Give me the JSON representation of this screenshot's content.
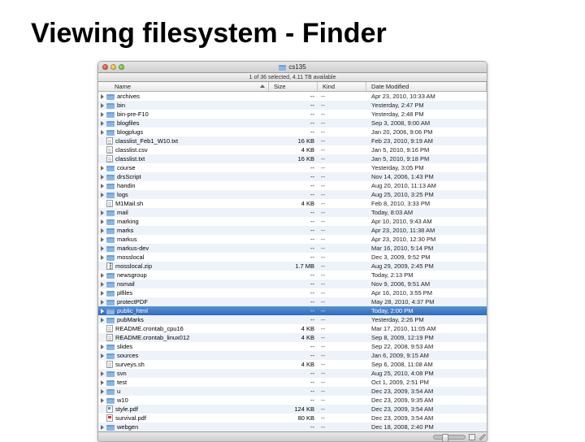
{
  "slide_title": "Viewing filesystem - Finder",
  "window_title": "cs135",
  "status_line": "1 of 36 selected, 4.11 TB available",
  "columns": {
    "name": "Name",
    "size": "Size",
    "kind": "Kind",
    "date": "Date Modified"
  },
  "rows": [
    {
      "tri": true,
      "icon": "folder",
      "name": "archives",
      "size": "--",
      "kind": "--",
      "date": "Apr 23, 2010, 10:33 AM"
    },
    {
      "tri": true,
      "icon": "folder",
      "name": "bin",
      "size": "--",
      "kind": "--",
      "date": "Yesterday, 2:47 PM"
    },
    {
      "tri": true,
      "icon": "folder",
      "name": "bin-pre-F10",
      "size": "--",
      "kind": "--",
      "date": "Yesterday, 2:48 PM"
    },
    {
      "tri": true,
      "icon": "folder",
      "name": "blogfiles",
      "size": "--",
      "kind": "--",
      "date": "Sep 3, 2008, 9:00 AM"
    },
    {
      "tri": true,
      "icon": "folder",
      "name": "blogplugs",
      "size": "--",
      "kind": "--",
      "date": "Jan 20, 2006, 9:06 PM"
    },
    {
      "tri": false,
      "icon": "file",
      "name": "classlist_Feb1_W10.txt",
      "size": "16 KB",
      "kind": "--",
      "date": "Feb 23, 2010, 9:19 AM"
    },
    {
      "tri": false,
      "icon": "file",
      "name": "classlist.csv",
      "size": "4 KB",
      "kind": "--",
      "date": "Jan 5, 2010, 9:16 PM"
    },
    {
      "tri": false,
      "icon": "file",
      "name": "classlist.txt",
      "size": "16 KB",
      "kind": "--",
      "date": "Jan 5, 2010, 9:18 PM"
    },
    {
      "tri": true,
      "icon": "folder",
      "name": "course",
      "size": "--",
      "kind": "--",
      "date": "Yesterday, 3:05 PM"
    },
    {
      "tri": true,
      "icon": "folder",
      "name": "drsScript",
      "size": "--",
      "kind": "--",
      "date": "Nov 14, 2006, 1:43 PM"
    },
    {
      "tri": true,
      "icon": "folder",
      "name": "handin",
      "size": "--",
      "kind": "--",
      "date": "Aug 20, 2010, 11:13 AM"
    },
    {
      "tri": true,
      "icon": "folder",
      "name": "logs",
      "size": "--",
      "kind": "--",
      "date": "Aug 25, 2010, 3:25 PM"
    },
    {
      "tri": false,
      "icon": "file",
      "name": "M1Mail.sh",
      "size": "4 KB",
      "kind": "--",
      "date": "Feb 8, 2010, 3:33 PM"
    },
    {
      "tri": true,
      "icon": "folder",
      "name": "mail",
      "size": "--",
      "kind": "--",
      "date": "Today, 8:03 AM"
    },
    {
      "tri": true,
      "icon": "folder",
      "name": "marking",
      "size": "--",
      "kind": "--",
      "date": "Apr 10, 2010, 9:43 AM"
    },
    {
      "tri": true,
      "icon": "folder",
      "name": "marks",
      "size": "--",
      "kind": "--",
      "date": "Apr 23, 2010, 11:38 AM"
    },
    {
      "tri": true,
      "icon": "folder",
      "name": "markus",
      "size": "--",
      "kind": "--",
      "date": "Apr 23, 2010, 12:30 PM"
    },
    {
      "tri": true,
      "icon": "folder",
      "name": "markus-dev",
      "size": "--",
      "kind": "--",
      "date": "Mar 16, 2010, 5:14 PM"
    },
    {
      "tri": true,
      "icon": "folder",
      "name": "mosslocal",
      "size": "--",
      "kind": "--",
      "date": "Dec 3, 2009, 9:52 PM"
    },
    {
      "tri": false,
      "icon": "zip",
      "name": "mosslocal.zip",
      "size": "1.7 MB",
      "kind": "--",
      "date": "Aug 29, 2009, 2:45 PM"
    },
    {
      "tri": true,
      "icon": "folder",
      "name": "newsgroup",
      "size": "--",
      "kind": "--",
      "date": "Today, 2:13 PM"
    },
    {
      "tri": true,
      "icon": "folder",
      "name": "nsmail",
      "size": "--",
      "kind": "--",
      "date": "Nov 9, 2006, 9:51 AM"
    },
    {
      "tri": true,
      "icon": "folder",
      "name": "plfiles",
      "size": "--",
      "kind": "--",
      "date": "Apr 16, 2010, 3:55 PM"
    },
    {
      "tri": true,
      "icon": "folder",
      "name": "protectPDF",
      "size": "--",
      "kind": "--",
      "date": "May 28, 2010, 4:37 PM"
    },
    {
      "tri": true,
      "icon": "folder",
      "name": "public_html",
      "size": "--",
      "kind": "--",
      "date": "Today, 2:00 PM",
      "selected": true
    },
    {
      "tri": true,
      "icon": "folder",
      "name": "pubMarks",
      "size": "--",
      "kind": "--",
      "date": "Yesterday, 2:26 PM"
    },
    {
      "tri": false,
      "icon": "file",
      "name": "README.crontab_cpu16",
      "size": "4 KB",
      "kind": "--",
      "date": "Mar 17, 2010, 11:05 AM"
    },
    {
      "tri": false,
      "icon": "file",
      "name": "README.crontab_linux012",
      "size": "4 KB",
      "kind": "--",
      "date": "Sep 8, 2009, 12:19 PM"
    },
    {
      "tri": true,
      "icon": "folder",
      "name": "slides",
      "size": "--",
      "kind": "--",
      "date": "Sep 22, 2008, 9:53 AM"
    },
    {
      "tri": true,
      "icon": "folder",
      "name": "sources",
      "size": "--",
      "kind": "--",
      "date": "Jan 6, 2009, 9:15 AM"
    },
    {
      "tri": false,
      "icon": "file",
      "name": "surveys.sh",
      "size": "4 KB",
      "kind": "--",
      "date": "Sep 6, 2008, 11:08 AM"
    },
    {
      "tri": true,
      "icon": "folder",
      "name": "svn",
      "size": "--",
      "kind": "--",
      "date": "Aug 25, 2010, 4:08 PM"
    },
    {
      "tri": true,
      "icon": "folder",
      "name": "test",
      "size": "--",
      "kind": "--",
      "date": "Oct 1, 2009, 2:51 PM"
    },
    {
      "tri": true,
      "icon": "folder",
      "name": "u",
      "size": "--",
      "kind": "--",
      "date": "Dec 23, 2009, 3:54 AM"
    },
    {
      "tri": true,
      "icon": "folder",
      "name": "w10",
      "size": "--",
      "kind": "--",
      "date": "Dec 23, 2009, 9:35 AM"
    },
    {
      "tri": false,
      "icon": "css",
      "name": "style.pdf",
      "size": "124 KB",
      "kind": "--",
      "date": "Dec 23, 2009, 3:54 AM"
    },
    {
      "tri": false,
      "icon": "pdf",
      "name": "survival.pdf",
      "size": "80 KB",
      "kind": "--",
      "date": "Dec 23, 2009, 3:54 AM"
    },
    {
      "tri": true,
      "icon": "folder",
      "name": "webgen",
      "size": "--",
      "kind": "--",
      "date": "Dec 18, 2008, 2:40 PM"
    }
  ]
}
